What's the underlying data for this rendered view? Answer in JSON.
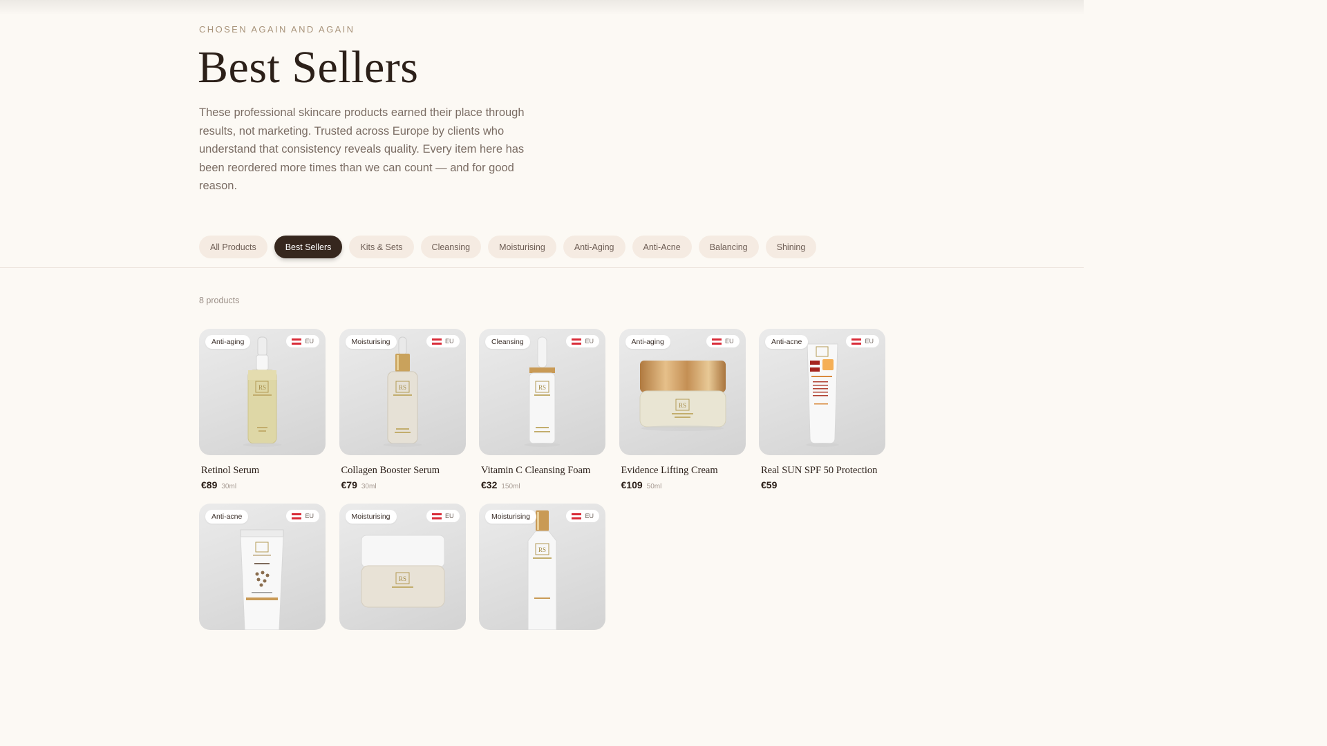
{
  "header": {
    "eyebrow": "CHOSEN AGAIN AND AGAIN",
    "title": "Best Sellers",
    "intro": "These professional skincare products earned their place through results, not marketing. Trusted across Europe by clients who understand that consistency reveals quality. Every item here has been reordered more times than we can count — and for good reason."
  },
  "filters": [
    {
      "label": "All Products"
    },
    {
      "label": "Best Sellers"
    },
    {
      "label": "Kits & Sets"
    },
    {
      "label": "Cleansing"
    },
    {
      "label": "Moisturising"
    },
    {
      "label": "Anti-Aging"
    },
    {
      "label": "Anti-Acne"
    },
    {
      "label": "Balancing"
    },
    {
      "label": "Shining"
    }
  ],
  "active_filter": "Best Sellers",
  "count": "8 products",
  "eu_label": "EU",
  "colors": {
    "accent": "#36271e",
    "chip_bg": "#f5ebe2",
    "background": "#fcf9f4",
    "flag": "#d92b37"
  },
  "products": [
    {
      "tag": "Anti-aging",
      "name": "Retinol Serum",
      "price": "€89",
      "size": "30ml",
      "visual": "dropper-bottle-yellow"
    },
    {
      "tag": "Moisturising",
      "name": "Collagen Booster Serum",
      "price": "€79",
      "size": "30ml",
      "visual": "dropper-bottle-gold"
    },
    {
      "tag": "Cleansing",
      "name": "Vitamin C Cleansing Foam",
      "price": "€32",
      "size": "150ml",
      "visual": "foam-pump-bottle"
    },
    {
      "tag": "Anti-aging",
      "name": "Evidence Lifting Cream",
      "price": "€109",
      "size": "50ml",
      "visual": "cream-jar-gold"
    },
    {
      "tag": "Anti-acne",
      "name": "Real SUN SPF 50 Protection",
      "price": "€59",
      "size": "",
      "visual": "sunscreen-tube"
    },
    {
      "tag": "Anti-acne",
      "name": "",
      "price": "",
      "size": "",
      "visual": "enzyme-peel-tube"
    },
    {
      "tag": "Moisturising",
      "name": "",
      "price": "",
      "size": "",
      "visual": "cream-jar-white"
    },
    {
      "tag": "Moisturising",
      "name": "",
      "price": "",
      "size": "",
      "visual": "hydra-tonic-bottle"
    }
  ]
}
